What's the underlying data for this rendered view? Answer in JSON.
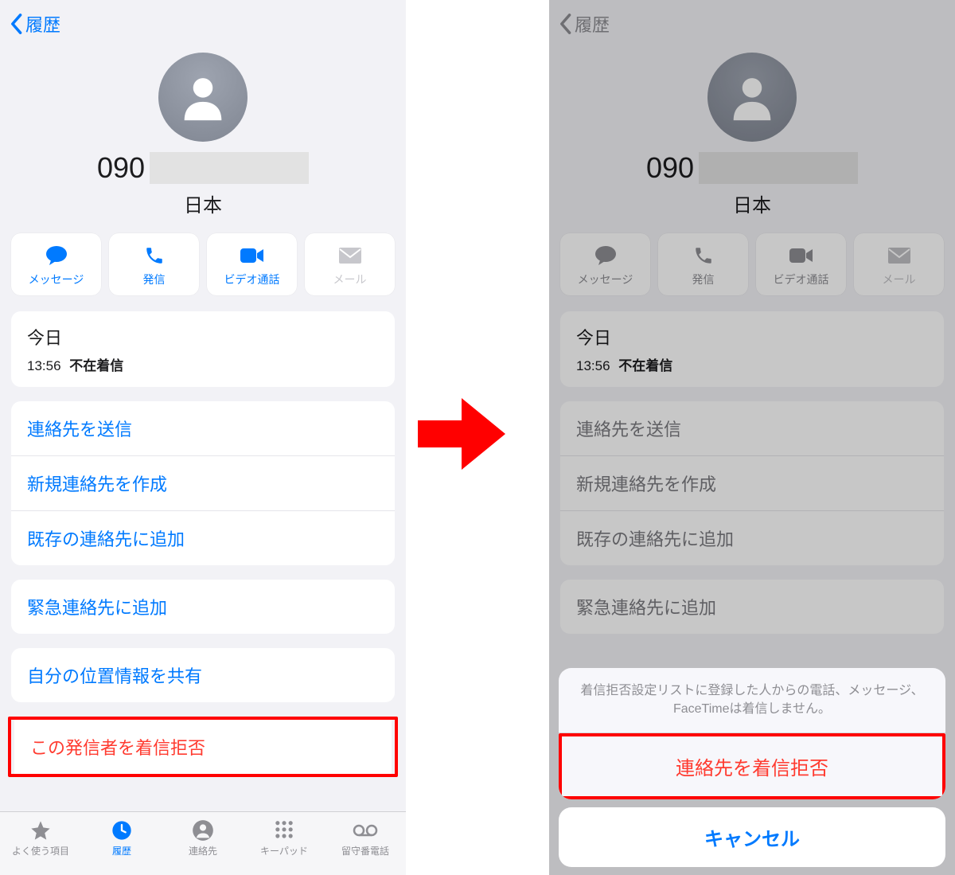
{
  "nav": {
    "back_label": "履歴"
  },
  "contact": {
    "number_prefix": "090",
    "country": "日本"
  },
  "actions": {
    "message": "メッセージ",
    "call": "発信",
    "video": "ビデオ通話",
    "mail": "メール"
  },
  "call_log": {
    "header": "今日",
    "time": "13:56",
    "status": "不在着信"
  },
  "options": {
    "share_contact": "連絡先を送信",
    "create_contact": "新規連絡先を作成",
    "add_existing": "既存の連絡先に追加",
    "emergency": "緊急連絡先に追加",
    "share_location": "自分の位置情報を共有",
    "block_caller": "この発信者を着信拒否"
  },
  "tabs": {
    "favorites": "よく使う項目",
    "recents": "履歴",
    "contacts": "連絡先",
    "keypad": "キーパッド",
    "voicemail": "留守番電話"
  },
  "sheet": {
    "message": "着信拒否設定リストに登録した人からの電話、メッセージ、FaceTimeは着信しません。",
    "block_action": "連絡先を着信拒否",
    "cancel": "キャンセル"
  }
}
